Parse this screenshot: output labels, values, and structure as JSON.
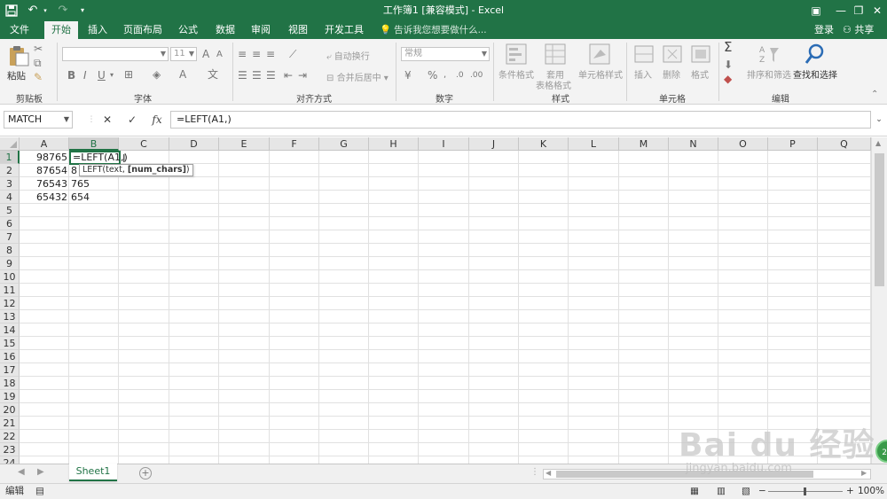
{
  "window": {
    "title": "工作簿1  [兼容模式] - Excel",
    "save_icon": "save-icon",
    "undo_icon": "undo-icon",
    "redo_icon": "redo-icon",
    "customize_icon": "customize-icon"
  },
  "tabs": [
    {
      "label": "文件"
    },
    {
      "label": "开始"
    },
    {
      "label": "插入"
    },
    {
      "label": "页面布局"
    },
    {
      "label": "公式"
    },
    {
      "label": "数据"
    },
    {
      "label": "审阅"
    },
    {
      "label": "视图"
    },
    {
      "label": "开发工具"
    }
  ],
  "tell_me": "告诉我您想要做什么...",
  "account": {
    "login": "登录",
    "share": "共享"
  },
  "ribbon": {
    "clipboard": {
      "paste": "粘贴",
      "label": "剪贴板"
    },
    "font": {
      "font_name": "",
      "font_size": "11",
      "label": "字体",
      "bold": "B",
      "italic": "I",
      "underline": "U"
    },
    "alignment": {
      "wrap": "自动换行",
      "merge": "合并后居中",
      "label": "对齐方式"
    },
    "number": {
      "format": "常规",
      "label": "数字"
    },
    "styles": {
      "conditional": "条件格式",
      "table_line1": "套用",
      "table_line2": "表格格式",
      "cell_styles": "单元格样式",
      "label": "样式"
    },
    "cells": {
      "insert": "插入",
      "delete": "删除",
      "format": "格式",
      "label": "单元格"
    },
    "editing": {
      "sort": "排序和筛选",
      "find": "查找和选择",
      "label": "编辑"
    }
  },
  "formula_bar": {
    "name_box": "MATCH",
    "cancel": "✕",
    "enter": "✓",
    "fx": "fx",
    "formula": "=LEFT(A1,)"
  },
  "columns": [
    "A",
    "B",
    "C",
    "D",
    "E",
    "F",
    "G",
    "H",
    "I",
    "J",
    "K",
    "L",
    "M",
    "N",
    "O",
    "P",
    "Q"
  ],
  "rows": [
    "1",
    "2",
    "3",
    "4",
    "5",
    "6",
    "7",
    "8",
    "9",
    "10",
    "11",
    "12",
    "13",
    "14",
    "15",
    "16",
    "17",
    "18",
    "19",
    "20",
    "21",
    "22",
    "23",
    "24"
  ],
  "cells": {
    "A1": "98765",
    "A2": "87654",
    "A3": "76543",
    "A4": "65432",
    "B2": "8",
    "B3": "765",
    "B4": "654"
  },
  "active_cell_text": "=LEFT(A1,)",
  "tooltip": {
    "prefix": "LEFT(text, ",
    "bold": "[num_chars]",
    "suffix": ")"
  },
  "sheet": {
    "tab": "Sheet1",
    "add": "+"
  },
  "status": {
    "mode": "编辑",
    "zoom": "100%",
    "zoom_minus": "−",
    "zoom_plus": "+"
  },
  "watermark": {
    "logo": "Bai du 经验",
    "url": "jingyan.baidu.com"
  },
  "badge": "29"
}
